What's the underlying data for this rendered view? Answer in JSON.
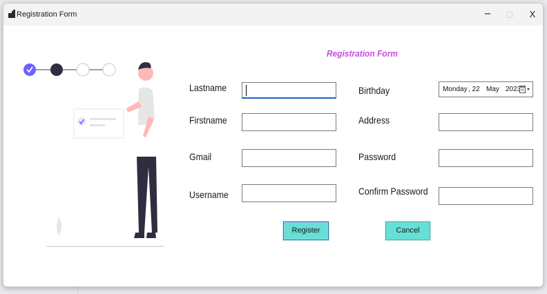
{
  "window": {
    "title": "Registration Form",
    "minimize_glyph": "−",
    "maximize_glyph": "▢",
    "close_glyph": "X"
  },
  "form": {
    "title": "Registration Form",
    "fields": {
      "lastname": {
        "label": "Lastname",
        "value": ""
      },
      "firstname": {
        "label": "Firstname",
        "value": ""
      },
      "gmail": {
        "label": "Gmail",
        "value": ""
      },
      "username": {
        "label": "Username",
        "value": ""
      },
      "birthday": {
        "label": "Birthday",
        "day_name": "Monday",
        "day": ", 22",
        "month": "May",
        "year": "2023"
      },
      "address": {
        "label": "Address",
        "value": ""
      },
      "password": {
        "label": "Password",
        "value": ""
      },
      "confirm_password": {
        "label": "Confirm Password",
        "value": ""
      }
    },
    "register_label": "Register",
    "cancel_label": "Cancel"
  },
  "colors": {
    "accent_title": "#c64ddc",
    "button_bg": "#66e0d6",
    "step_active": "#6c63ff",
    "step_dark": "#2f2e41"
  },
  "icons": [
    "app-icon",
    "check-icon",
    "calendar-icon",
    "dropdown-arrow-icon"
  ]
}
